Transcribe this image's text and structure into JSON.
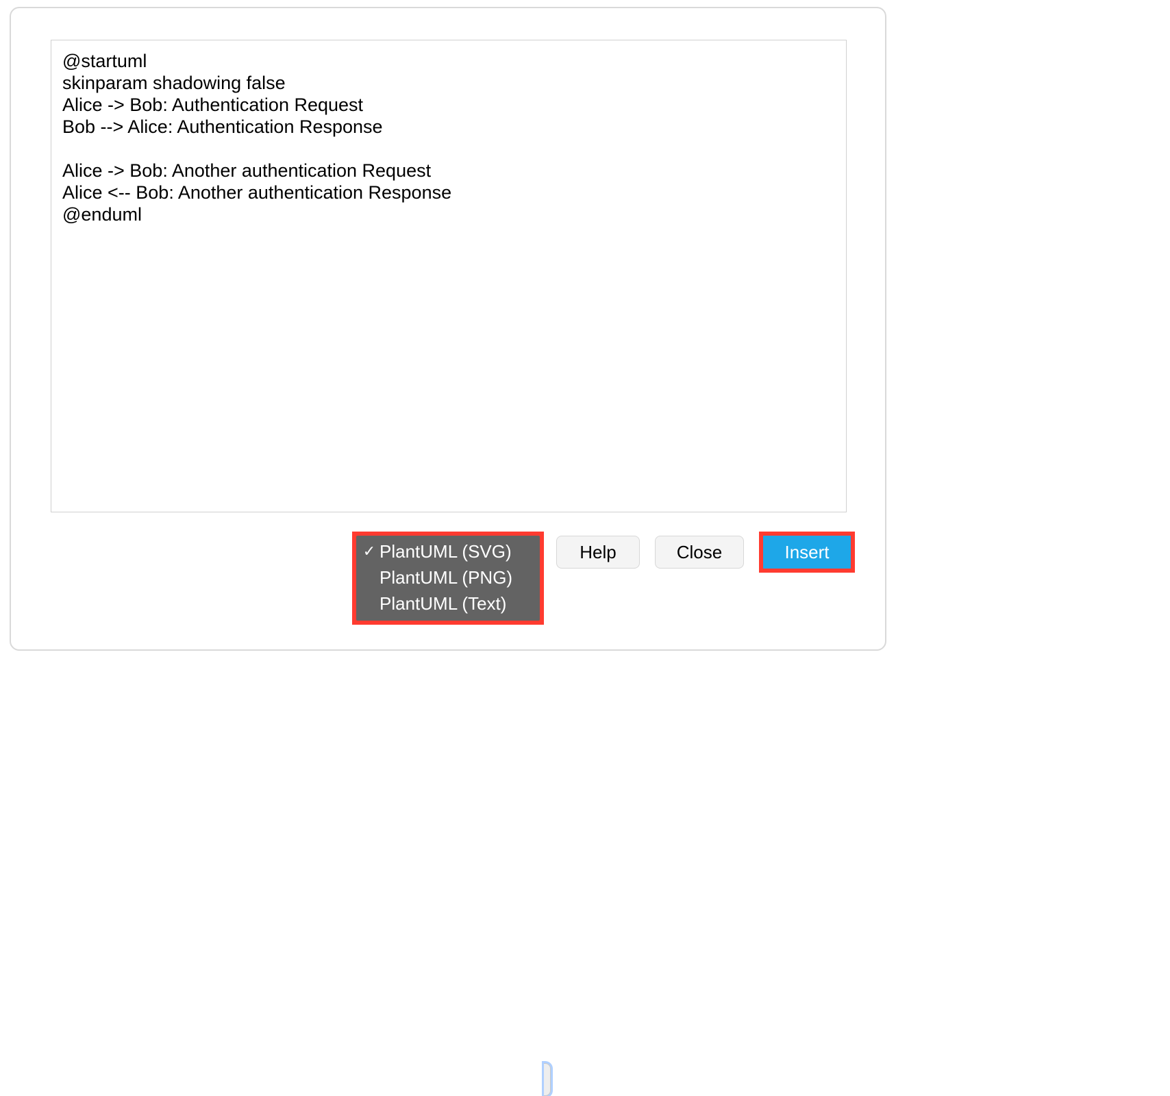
{
  "editor": {
    "code": "@startuml\nskinparam shadowing false\nAlice -> Bob: Authentication Request\nBob --> Alice: Authentication Response\n\nAlice -> Bob: Another authentication Request\nAlice <-- Bob: Another authentication Response\n@enduml"
  },
  "buttons": {
    "help": "Help",
    "close": "Close",
    "insert": "Insert"
  },
  "format_menu": {
    "items": [
      {
        "label": "PlantUML (SVG)",
        "selected": true
      },
      {
        "label": "PlantUML (PNG)",
        "selected": false
      },
      {
        "label": "PlantUML (Text)",
        "selected": false
      }
    ]
  },
  "colors": {
    "highlight": "#ff3b30",
    "primary": "#1ea7e8",
    "menu_bg": "#636363"
  }
}
